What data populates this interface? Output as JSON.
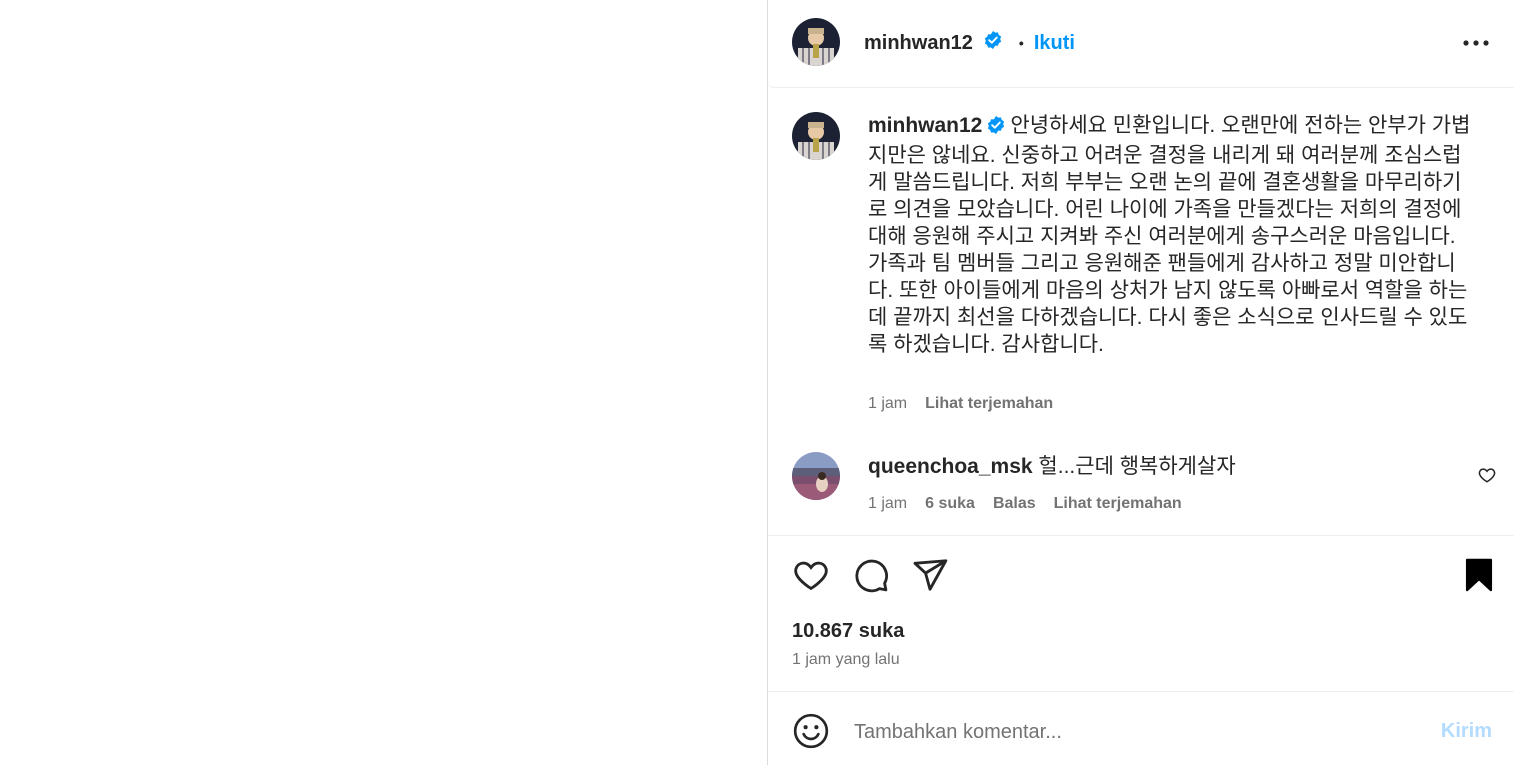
{
  "header": {
    "username": "minhwan12",
    "separator": "•",
    "follow_label": "Ikuti"
  },
  "caption": {
    "username": "minhwan12",
    "text": "안녕하세요 민환입니다. 오랜만에 전하는 안부가 가볍지만은 않네요. 신중하고 어려운 결정을 내리게 돼 여러분께 조심스럽게 말씀드립니다. 저희 부부는 오랜 논의 끝에 결혼생활을 마무리하기로 의견을 모았습니다. 어린 나이에 가족을 만들겠다는 저희의 결정에 대해 응원해 주시고 지켜봐 주신 여러분에게 송구스러운 마음입니다. 가족과 팀 멤버들 그리고 응원해준 팬들에게 감사하고 정말 미안합니다. 또한 아이들에게 마음의 상처가 남지 않도록 아빠로서 역할을 하는데 끝까지 최선을 다하겠습니다. 다시 좋은 소식으로 인사드릴 수 있도록 하겠습니다. 감사합니다.",
    "time": "1 jam",
    "translate_label": "Lihat terjemahan"
  },
  "comments": [
    {
      "username": "queenchoa_msk",
      "text": "헐...근데 행복하게살자",
      "time": "1 jam",
      "likes": "6 suka",
      "reply_label": "Balas",
      "translate_label": "Lihat terjemahan"
    }
  ],
  "post": {
    "likes": "10.867 suka",
    "posted_ago": "1 jam yang lalu"
  },
  "composer": {
    "placeholder": "Tambahkan komentar...",
    "send_label": "Kirim"
  },
  "icons": {
    "verified": "verified-badge-icon",
    "more": "more-options-icon",
    "like": "heart-icon",
    "comment": "comment-bubble-icon",
    "share": "paper-plane-icon",
    "save": "bookmark-filled-icon",
    "emoji": "smiley-icon"
  },
  "colors": {
    "accent": "#0095f6",
    "verified": "#0095f6",
    "muted": "#737373",
    "send_disabled": "#b3dbff"
  }
}
